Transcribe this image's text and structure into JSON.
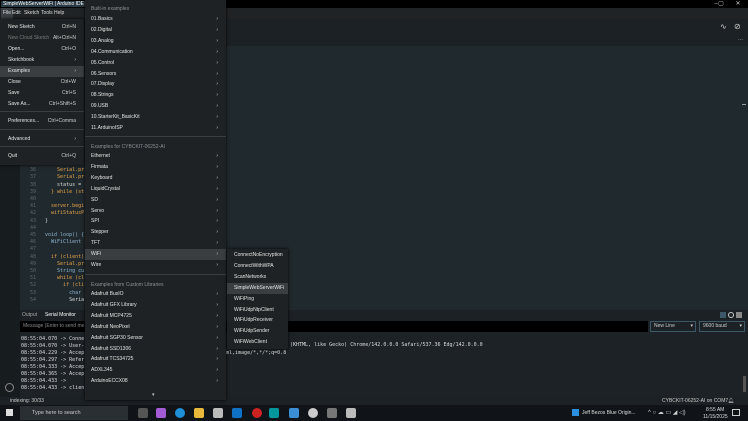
{
  "window": {
    "title": "SimpleWebServerWiFi | Arduino IDE",
    "minimize": "–",
    "maximize": "▢",
    "close": "✕"
  },
  "menubar": [
    "File",
    "Edit",
    "Sketch",
    "Tools",
    "Help"
  ],
  "file_menu": [
    {
      "label": "New Sketch",
      "shortcut": "Ctrl+N"
    },
    {
      "label": "New Cloud Sketch",
      "shortcut": "Alt+Ctrl+N",
      "disabled": true
    },
    {
      "label": "Open...",
      "shortcut": "Ctrl+O"
    },
    {
      "label": "Sketchbook",
      "shortcut": "›"
    },
    {
      "label": "Examples",
      "shortcut": "›",
      "selected": true
    },
    {
      "label": "Close",
      "shortcut": "Ctrl+W"
    },
    {
      "label": "Save",
      "shortcut": "Ctrl+S"
    },
    {
      "label": "Save As...",
      "shortcut": "Ctrl+Shift+S"
    },
    {
      "label": "Preferences...",
      "shortcut": "Ctrl+Comma"
    },
    {
      "label": "Advanced",
      "shortcut": "›"
    },
    {
      "label": "Quit",
      "shortcut": "Ctrl+Q"
    }
  ],
  "examples_menu": {
    "builtin_header": "Built-in examples",
    "builtin": [
      "01.Basics",
      "02.Digital",
      "03.Analog",
      "04.Communication",
      "05.Control",
      "06.Sensors",
      "07.Display",
      "08.Strings",
      "09.USB",
      "10.StarterKit_BasicKit",
      "11.ArduinoISP"
    ],
    "board_header": "Examples for CYBCKIT-06252-AI",
    "board": [
      "Ethernet",
      "Firmata",
      "Keyboard",
      "LiquidCrystal",
      "SD",
      "Servo",
      "SPI",
      "Stepper",
      "TFT",
      "WiFi",
      "Wire"
    ],
    "board_selected": "WiFi",
    "custom_header": "Examples from Custom Libraries",
    "custom": [
      "Adafruit BusIO",
      "Adafruit GFX Library",
      "Adafruit MCP4725",
      "Adafruit NeoPixel",
      "Adafruit SGP30 Sensor",
      "Adafruit SSD1306",
      "Adafruit TCS34725",
      "ADXL345",
      "ArduinoECCX08"
    ],
    "arrow": "›",
    "scroll_down": "▾"
  },
  "wifi_menu": {
    "items": [
      "ConnectNoEncryption",
      "ConnectWithWPA",
      "ScanNetworks",
      "SimpleWebServerWiFi",
      "WiFiPing",
      "WiFiUdpNtpClient",
      "WiFiUdpReceiver",
      "WiFiUdpSender",
      "WiFiWebClient"
    ],
    "selected": "SimpleWebServerWiFi"
  },
  "editor": {
    "lines": [
      {
        "n": "35",
        "t": "  do {"
      },
      {
        "n": "36",
        "t": "    Serial.pr"
      },
      {
        "n": "37",
        "t": "    Serial.pr"
      },
      {
        "n": "38",
        "t": "    status ="
      },
      {
        "n": "39",
        "t": "  } while (st"
      },
      {
        "n": "40",
        "t": ""
      },
      {
        "n": "41",
        "t": "  server.begi"
      },
      {
        "n": "42",
        "t": "  wifiStatusP"
      },
      {
        "n": "43",
        "t": "}"
      },
      {
        "n": "44",
        "t": ""
      },
      {
        "n": "45",
        "t": "void loop() {"
      },
      {
        "n": "46",
        "t": "  WiFiClient"
      },
      {
        "n": "47",
        "t": ""
      },
      {
        "n": "48",
        "t": "  if (client)"
      },
      {
        "n": "49",
        "t": "    Serial.pr"
      },
      {
        "n": "50",
        "t": "    String cu"
      },
      {
        "n": "51",
        "t": "    while (cl"
      },
      {
        "n": "52",
        "t": "      if (cli"
      },
      {
        "n": "53",
        "t": "        char"
      },
      {
        "n": "54",
        "t": "        Seria"
      }
    ],
    "more_icon": "···"
  },
  "panel": {
    "tabs": [
      "Output",
      "Serial Monitor"
    ],
    "message_placeholder": "Message (Enter to send me",
    "line_ending": "New Line",
    "baud": "9600 baud"
  },
  "serial": {
    "lines": [
      "08:55:04.070 -> Conne",
      "08:55:04.070 -> User-",
      "08:55:04.229 -> Accep",
      "08:55:04.297 -> Refer",
      "08:55:04.333 -> Accep",
      "08:55:04.365 -> Accep",
      "08:55:04.433 -> ",
      "08:55:04.433 -> clien"
    ],
    "fragment_user_agent": "(KHTML, like Gecko) Chrome/142.0.0.0 Safari/537.36 Edg/142.0.0.0",
    "fragment_accept": "ml,image/*,*/*;q=0.8"
  },
  "statusbar": {
    "left": "indexing: 30/33",
    "right": "CYBCKIT-06252-AI on COM7"
  },
  "taskbar": {
    "search_placeholder": "Type here to search",
    "news": "Jeff Bezos Blue Origin...",
    "time": "8:55 AM",
    "date": "11/15/2025"
  },
  "colors": {
    "accent": "#00979d",
    "menu_bg": "#1f2224",
    "selected": "#3b3e41"
  }
}
